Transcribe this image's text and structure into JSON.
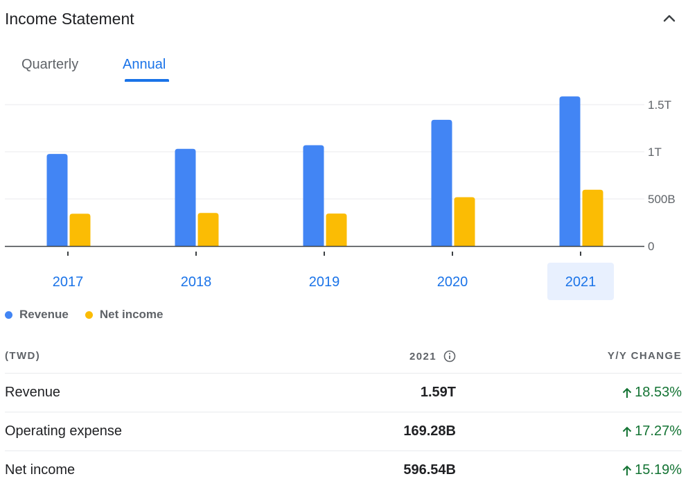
{
  "header": {
    "title": "Income Statement"
  },
  "tabs": [
    {
      "label": "Quarterly",
      "selected": false
    },
    {
      "label": "Annual",
      "selected": true
    }
  ],
  "colors": {
    "revenue": "#4285f4",
    "net_income": "#fbbc04",
    "accent": "#1a73e8",
    "positive": "#137333",
    "selected_year_bg": "#e8f0fe"
  },
  "chart_data": {
    "type": "bar",
    "categories": [
      "2017",
      "2018",
      "2019",
      "2020",
      "2021"
    ],
    "selected_category": "2021",
    "series": [
      {
        "name": "Revenue",
        "values": [
          977,
          1031,
          1070,
          1339,
          1587
        ]
      },
      {
        "name": "Net income",
        "values": [
          343,
          351,
          345,
          518,
          597
        ]
      }
    ],
    "units": "billions TWD",
    "ylim": [
      0,
      1500
    ],
    "yticks": [
      {
        "value": 0,
        "label": "0"
      },
      {
        "value": 500,
        "label": "500B"
      },
      {
        "value": 1000,
        "label": "1T"
      },
      {
        "value": 1500,
        "label": "1.5T"
      }
    ],
    "grid": true,
    "legend_position": "bottom-left"
  },
  "legend": [
    {
      "label": "Revenue",
      "icon": "circle-blue-icon"
    },
    {
      "label": "Net income",
      "icon": "circle-yellow-icon"
    }
  ],
  "table": {
    "currency_label": "(TWD)",
    "year_label": "2021",
    "change_label": "Y/Y CHANGE",
    "rows": [
      {
        "label": "Revenue",
        "value": "1.59T",
        "change": "18.53%"
      },
      {
        "label": "Operating expense",
        "value": "169.28B",
        "change": "17.27%"
      },
      {
        "label": "Net income",
        "value": "596.54B",
        "change": "15.19%"
      }
    ]
  }
}
